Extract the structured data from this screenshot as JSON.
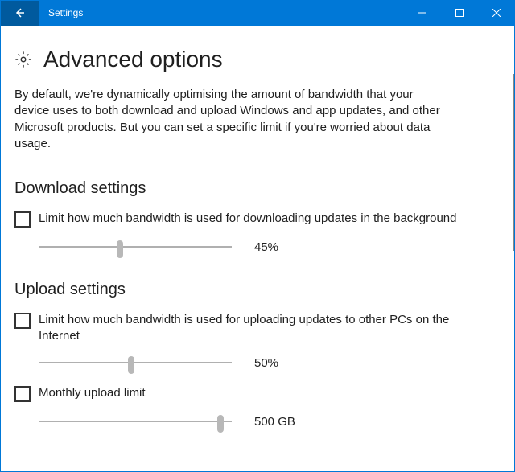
{
  "titlebar": {
    "title": "Settings"
  },
  "header": {
    "title": "Advanced options"
  },
  "description": "By default, we're dynamically optimising the amount of bandwidth that your device uses to both download and upload Windows and app updates, and other Microsoft products. But you can set a specific limit if you're worried about data usage.",
  "download": {
    "section_title": "Download settings",
    "checkbox_label": "Limit how much bandwidth is used for downloading updates in the background",
    "slider_value": "45%",
    "slider_percent": 42
  },
  "upload": {
    "section_title": "Upload settings",
    "checkbox_label": "Limit how much bandwidth is used for uploading updates to other PCs on the Internet",
    "slider_value": "50%",
    "slider_percent": 48,
    "monthly_label": "Monthly upload limit",
    "monthly_value": "500 GB",
    "monthly_percent": 94
  }
}
